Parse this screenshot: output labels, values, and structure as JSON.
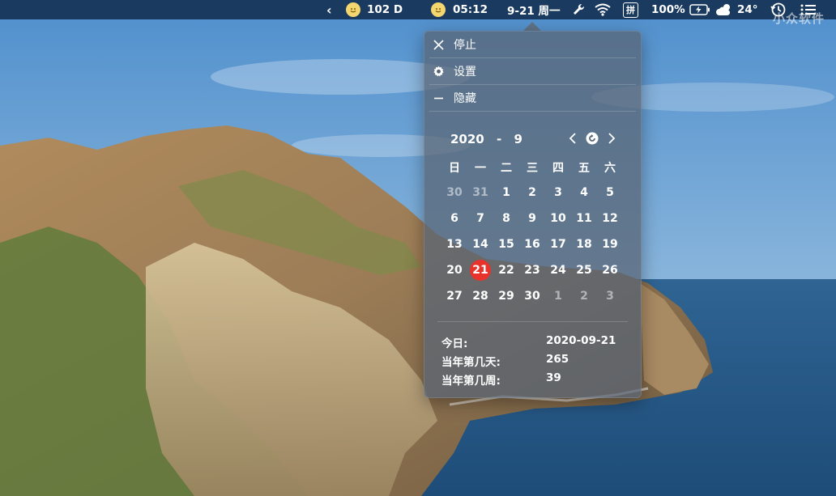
{
  "menubar": {
    "chevron": "‹",
    "badge_text": "102 D",
    "time": "05:12",
    "date": "9-21 周一",
    "input_method": "拼",
    "battery": "100%",
    "weather": "24°",
    "watermark": "小众软件"
  },
  "menu": {
    "stop_label": "停止",
    "settings_label": "设置",
    "hide_label": "隐藏"
  },
  "calendar": {
    "year": "2020",
    "dash": "-",
    "month": "9",
    "weekdays": [
      "日",
      "一",
      "二",
      "三",
      "四",
      "五",
      "六"
    ],
    "weeks": [
      [
        "30",
        "31",
        "1",
        "2",
        "3",
        "4",
        "5"
      ],
      [
        "6",
        "7",
        "8",
        "9",
        "10",
        "11",
        "12"
      ],
      [
        "13",
        "14",
        "15",
        "16",
        "17",
        "18",
        "19"
      ],
      [
        "20",
        "21",
        "22",
        "23",
        "24",
        "25",
        "26"
      ],
      [
        "27",
        "28",
        "29",
        "30",
        "1",
        "2",
        "3"
      ]
    ],
    "today": "21"
  },
  "info": {
    "today_label": "今日:",
    "today_value": "2020-09-21",
    "day_of_year_label": "当年第几天:",
    "day_of_year_value": "265",
    "week_of_year_label": "当年第几周:",
    "week_of_year_value": "39"
  },
  "colors": {
    "menubar_bg": "#163456",
    "today_highlight": "#e8322c",
    "badge_yellow": "#f3d66d"
  }
}
